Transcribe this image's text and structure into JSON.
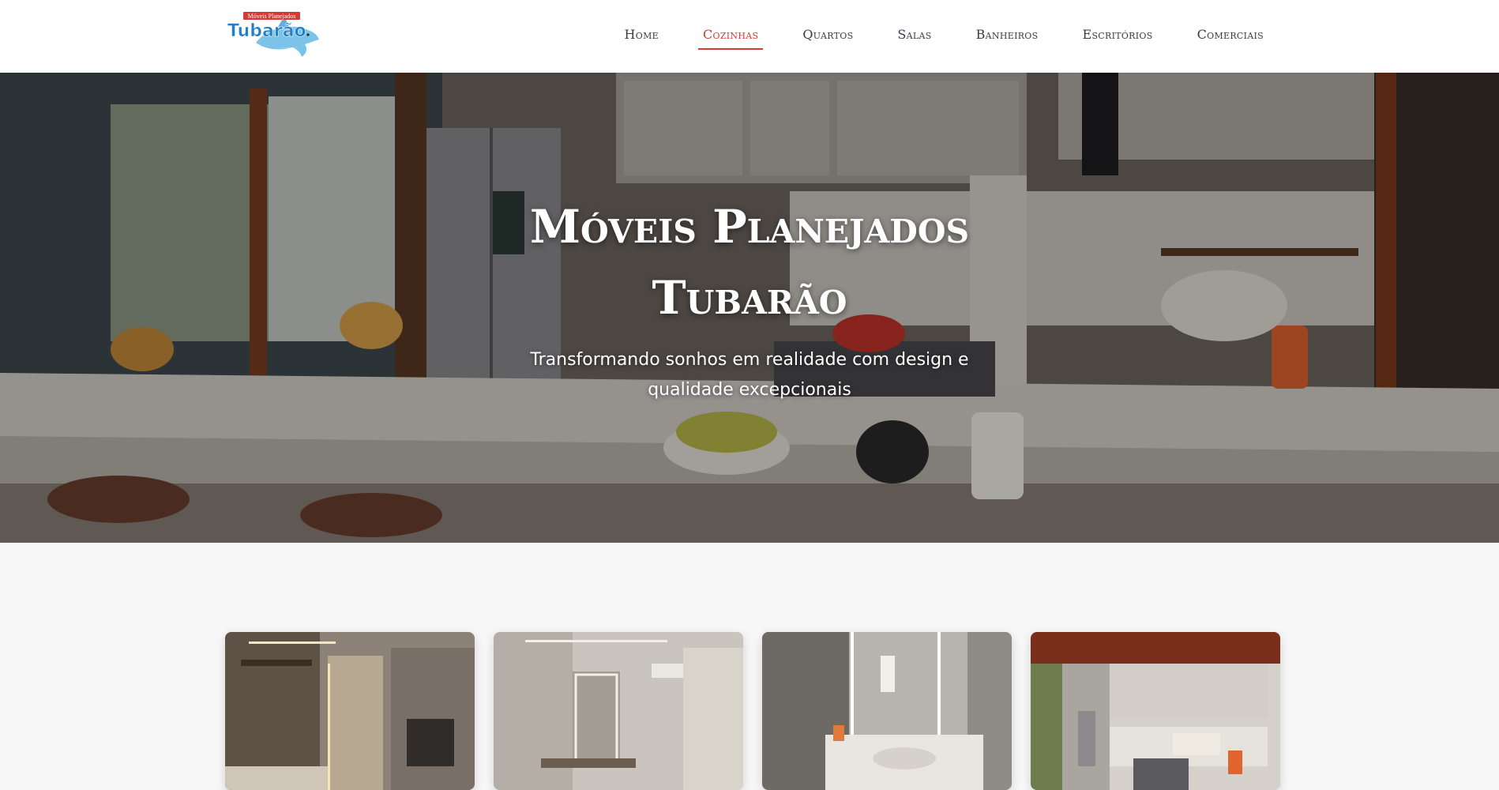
{
  "brand": {
    "logo_top_text": "Móveis Planejados",
    "logo_main_text": "Tubarão",
    "colors": {
      "red": "#d63a35",
      "blue": "#1f7fc8",
      "light_blue": "#7cc3ea"
    }
  },
  "nav": {
    "items": [
      {
        "label": "Home",
        "active": false
      },
      {
        "label": "Cozinhas",
        "active": true
      },
      {
        "label": "Quartos",
        "active": false
      },
      {
        "label": "Salas",
        "active": false
      },
      {
        "label": "Banheiros",
        "active": false
      },
      {
        "label": "Escritórios",
        "active": false
      },
      {
        "label": "Comerciais",
        "active": false
      }
    ],
    "active_color": "#d63a35"
  },
  "hero": {
    "title_line1": "Móveis Planejados",
    "title_line2": "Tubarão",
    "subtitle": "Transformando sonhos em realidade com design e qualidade excepcionais",
    "image_subject": "kitchen-photo"
  },
  "gallery": {
    "cards": [
      {
        "image_subject": "kitchen-with-led-lighting"
      },
      {
        "image_subject": "bedroom-vanity"
      },
      {
        "image_subject": "bathroom-vanity"
      },
      {
        "image_subject": "farmhouse-kitchen"
      }
    ]
  }
}
